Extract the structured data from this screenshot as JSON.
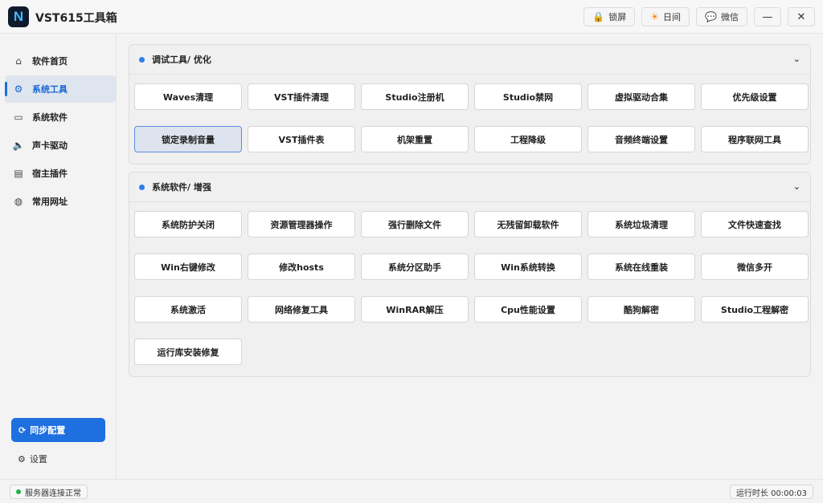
{
  "app": {
    "logo_letter": "N",
    "title": "VST615工具箱"
  },
  "titlebar": {
    "lock_label": "锁屏",
    "daynight_label": "日间",
    "wechat_label": "微信",
    "minimize_glyph": "—",
    "close_glyph": "✕"
  },
  "sidebar": {
    "items": [
      {
        "label": "软件首页",
        "icon": "⌂"
      },
      {
        "label": "系统工具",
        "icon": "⚙"
      },
      {
        "label": "系统软件",
        "icon": "▭"
      },
      {
        "label": "声卡驱动",
        "icon": "🔈"
      },
      {
        "label": "宿主插件",
        "icon": "▤"
      },
      {
        "label": "常用网址",
        "icon": "◍"
      }
    ],
    "sync_label": "同步配置",
    "sync_icon": "⟳",
    "settings_label": "设置",
    "settings_icon": "⚙"
  },
  "panels": [
    {
      "title": "调试工具/ 优化",
      "buttons": [
        "Waves清理",
        "VST插件清理",
        "Studio注册机",
        "Studio禁网",
        "虚拟驱动合集",
        "优先级设置",
        "锁定录制音量",
        "VST插件表",
        "机架重置",
        "工程降级",
        "音频终端设置",
        "程序联网工具"
      ]
    },
    {
      "title": "系统软件/ 增强",
      "buttons": [
        "系统防护关闭",
        "资源管理器操作",
        "强行删除文件",
        "无残留卸载软件",
        "系统垃圾清理",
        "文件快速查找",
        "Win右键修改",
        "修改hosts",
        "系统分区助手",
        "Win系统转换",
        "系统在线重装",
        "微信多开",
        "系统激活",
        "网络修复工具",
        "WinRAR解压",
        "Cpu性能设置",
        "酷狗解密",
        "Studio工程解密",
        "运行库安装修复"
      ]
    }
  ],
  "status": {
    "server_label": "服务器连接正常",
    "runtime_label": "运行时长 00:00:03"
  },
  "colors": {
    "accent": "#1e6fe0",
    "ok": "#22b14c"
  }
}
